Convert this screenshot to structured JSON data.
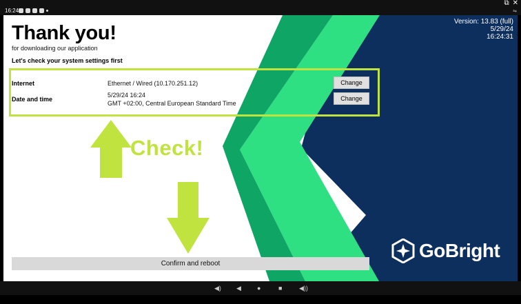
{
  "statusbar": {
    "time": "16:24",
    "icons": [
      "shield-icon",
      "notification-icon",
      "screen-icon",
      "image-icon",
      "dot-icon"
    ],
    "right_icons": [
      "sync-icon"
    ]
  },
  "window_controls": [
    "popout-icon",
    "close-icon"
  ],
  "header": {
    "title": "Thank you!",
    "subtitle": "for downloading our application",
    "check_heading": "Let's check your system settings first"
  },
  "version": {
    "version": "Version: 13.83 (full)",
    "date": "5/29/24",
    "time": "16:24:31"
  },
  "settings": [
    {
      "label": "Internet",
      "value_line1": "Ethernet / Wired (10.170.251.12)",
      "value_line2": "",
      "button_label": "Change"
    },
    {
      "label": "Date and time",
      "value_line1": "5/29/24 16:24",
      "value_line2": "GMT +02:00, Central European Standard Time",
      "button_label": "Change"
    }
  ],
  "annotation": {
    "check_label": "Check!",
    "color": "#c0e340"
  },
  "confirm_button_label": "Confirm and reboot",
  "brand": {
    "name": "GoBright"
  },
  "colors": {
    "navy": "#0d2f5e",
    "dark_green": "#0fa564",
    "light_green": "#2ee082",
    "accent": "#c0e340"
  },
  "navbar": [
    "volume-down-icon",
    "back-icon",
    "home-icon",
    "recents-icon",
    "volume-up-icon"
  ]
}
